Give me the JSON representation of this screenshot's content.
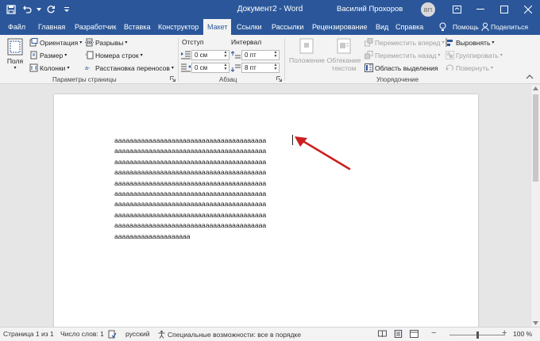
{
  "window": {
    "title": "Документ2 - Word",
    "user": "Василий Прохоров",
    "avatar_initials": "ВП"
  },
  "tabs": [
    {
      "label": "Файл"
    },
    {
      "label": "Главная"
    },
    {
      "label": "Разработчик"
    },
    {
      "label": "Вставка"
    },
    {
      "label": "Конструктор"
    },
    {
      "label": "Макет"
    },
    {
      "label": "Ссылки"
    },
    {
      "label": "Рассылки"
    },
    {
      "label": "Рецензирование"
    },
    {
      "label": "Вид"
    },
    {
      "label": "Справка"
    }
  ],
  "active_tab": "Макет",
  "help_label": "Помощь",
  "share_label": "Поделиться",
  "ribbon": {
    "page_setup": {
      "fields_label": "Поля",
      "orientation": "Ориентация",
      "size": "Размер",
      "columns": "Колонки",
      "breaks": "Разрывы",
      "line_numbers": "Номера строк",
      "hyphenation": "Расстановка переносов",
      "group_label": "Параметры страницы"
    },
    "paragraph": {
      "indent_label": "Отступ",
      "spacing_label": "Интервал",
      "indent_left": "0 см",
      "indent_right": "0 см",
      "spacing_before": "0 пт",
      "spacing_after": "8 пт",
      "group_label": "Абзац"
    },
    "arrange": {
      "position": "Положение",
      "wrap_text_1": "Обтекание",
      "wrap_text_2": "текстом",
      "bring_forward": "Переместить вперед",
      "send_backward": "Переместить назад",
      "selection_pane": "Область выделения",
      "align": "Выровнять",
      "group": "Группировать",
      "rotate": "Повернуть",
      "group_label": "Упорядочение"
    }
  },
  "document": {
    "lines": [
      "аааааааааааааааааааааааааааааааааааааааа",
      "аааааааааааааааааааааааааааааааааааааааа",
      "аааааааааааааааааааааааааааааааааааааааа",
      "аааааааааааааааааааааааааааааааааааааааа",
      "аааааааааааааааааааааааааааааааааааааааа",
      "аааааааааааааааааааааааааааааааааааааааа",
      "аааааааааааааааааааааааааааааааааааааааа",
      "аааааааааааааааааааааааааааааааааааааааа",
      "аааааааааааааааааааааааааааааааааааааааа",
      "аааааааааааааааааааа"
    ],
    "annotation_arrow_color": "#cc1f1f"
  },
  "status": {
    "page": "Страница 1 из 1",
    "words": "Число слов: 1",
    "language": "русский",
    "accessibility": "Специальные возможности: все в порядке",
    "zoom": "100 %",
    "zoom_fraction": 0.5
  },
  "colors": {
    "accent": "#2b579a",
    "ribbon_bg": "#f3f3f3",
    "canvas_bg": "#e6e6e6"
  }
}
